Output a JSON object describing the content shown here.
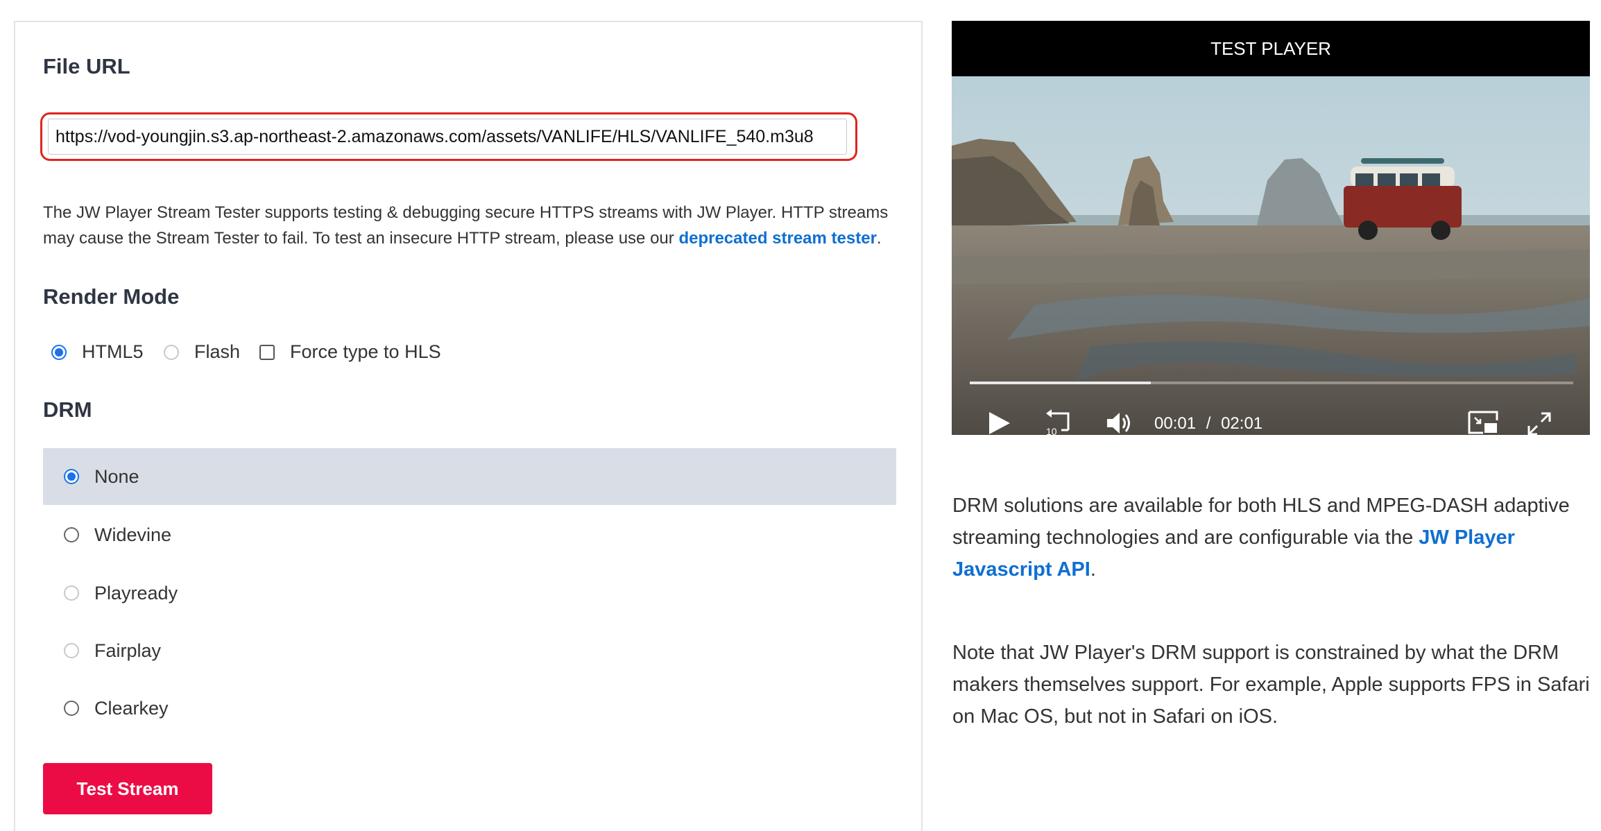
{
  "form": {
    "file_url_heading": "File URL",
    "file_url_value": "https://vod-youngjin.s3.ap-northeast-2.amazonaws.com/assets/VANLIFE/HLS/VANLIFE_540.m3u8",
    "description_text": "The JW Player Stream Tester supports testing & debugging secure HTTPS streams with JW Player. HTTP streams may cause the Stream Tester to fail. To test an insecure HTTP stream, please use our ",
    "description_link": "deprecated stream tester",
    "description_end": ".",
    "render_mode_heading": "Render Mode",
    "render_modes": [
      {
        "label": "HTML5",
        "selected": true
      },
      {
        "label": "Flash",
        "selected": false
      },
      {
        "label": "Force type to HLS",
        "checked": false
      }
    ],
    "drm_heading": "DRM",
    "drm_options": [
      {
        "label": "None",
        "selected": true
      },
      {
        "label": "Widevine",
        "selected": false
      },
      {
        "label": "Playready",
        "selected": false
      },
      {
        "label": "Fairplay",
        "selected": false
      },
      {
        "label": "Clearkey",
        "selected": false
      }
    ],
    "submit_label": "Test Stream"
  },
  "player": {
    "title": "TEST PLAYER",
    "current_time": "00:01",
    "separator": "/",
    "duration": "02:01",
    "progress": 0.3,
    "rewind_label": "10"
  },
  "info": {
    "p1_text": "DRM solutions are available for both HLS and MPEG-DASH adaptive streaming technologies and are configurable via the ",
    "p1_link": "JW Player Javascript API",
    "p1_end": ".",
    "p2_text": "Note that JW Player's DRM support is constrained by what the DRM makers themselves support. For example, Apple supports FPS in Safari on Mac OS, but not in Safari on iOS."
  },
  "colors": {
    "accent_button": "#ec0c45",
    "link": "#0f6fd1",
    "highlight_border": "#e0251b",
    "selected_row": "#d9dde6"
  }
}
